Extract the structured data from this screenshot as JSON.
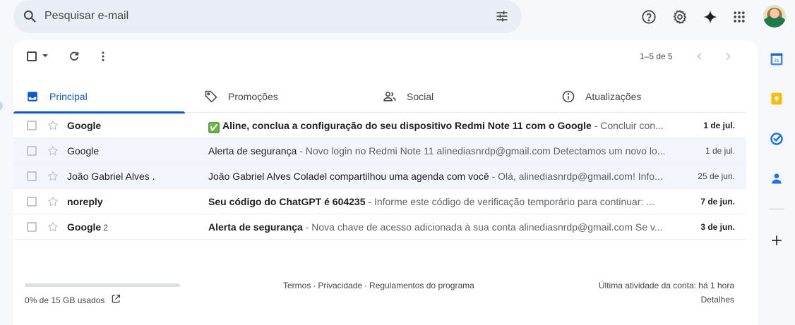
{
  "search": {
    "placeholder": "Pesquisar e-mail"
  },
  "toolbar": {
    "pager": "1–5 de 5"
  },
  "tabs": [
    {
      "label": "Principal",
      "icon": "inbox-icon",
      "active": true
    },
    {
      "label": "Promoções",
      "icon": "tag-icon",
      "active": false
    },
    {
      "label": "Social",
      "icon": "people-icon",
      "active": false
    },
    {
      "label": "Atualizações",
      "icon": "info-icon",
      "active": false
    }
  ],
  "emails": [
    {
      "sender": "Google",
      "count": "",
      "emoji": "✅",
      "subject": "Aline, conclua a configuração do seu dispositivo Redmi Note 11 com o Google",
      "snippet": " - Concluir con...",
      "date": "1 de jul.",
      "unread": true
    },
    {
      "sender": "Google",
      "count": "",
      "emoji": "",
      "subject": "Alerta de segurança",
      "snippet": " - Novo login no Redmi Note 11 alinediasnrdp@gmail.com Detectamos um novo lo...",
      "date": "1 de jul.",
      "unread": false
    },
    {
      "sender": "João Gabriel Alves .",
      "count": "",
      "emoji": "",
      "subject": "João Gabriel Alves Coladel compartilhou uma agenda com você",
      "snippet": " - Olá, alinediasnrdp@gmail.com! Info...",
      "date": "25 de jun.",
      "unread": false
    },
    {
      "sender": "noreply",
      "count": "",
      "emoji": "",
      "subject": "Seu código do ChatGPT é 604235",
      "snippet": " - Informe este código de verificação temporário para continuar: ...",
      "date": "7 de jun.",
      "unread": true
    },
    {
      "sender": "Google",
      "count": "2",
      "emoji": "",
      "subject": "Alerta de segurança",
      "snippet": " - Nova chave de acesso adicionada à sua conta alinediasnrdp@gmail.com Se v...",
      "date": "3 de jun.",
      "unread": true
    }
  ],
  "footer": {
    "storage_text": "0% de 15 GB usados",
    "storage_used_fraction": 0,
    "link_terms": "Termos",
    "link_privacy": "Privacidade",
    "link_policies": "Regulamentos do programa",
    "activity": "Última atividade da conta: há 1 hora",
    "details": "Detalhes"
  },
  "colors": {
    "accent": "#0b57d0",
    "background": "#f6f8fc",
    "search_bg": "#e9eef6",
    "read_row": "#f2f6fc"
  }
}
